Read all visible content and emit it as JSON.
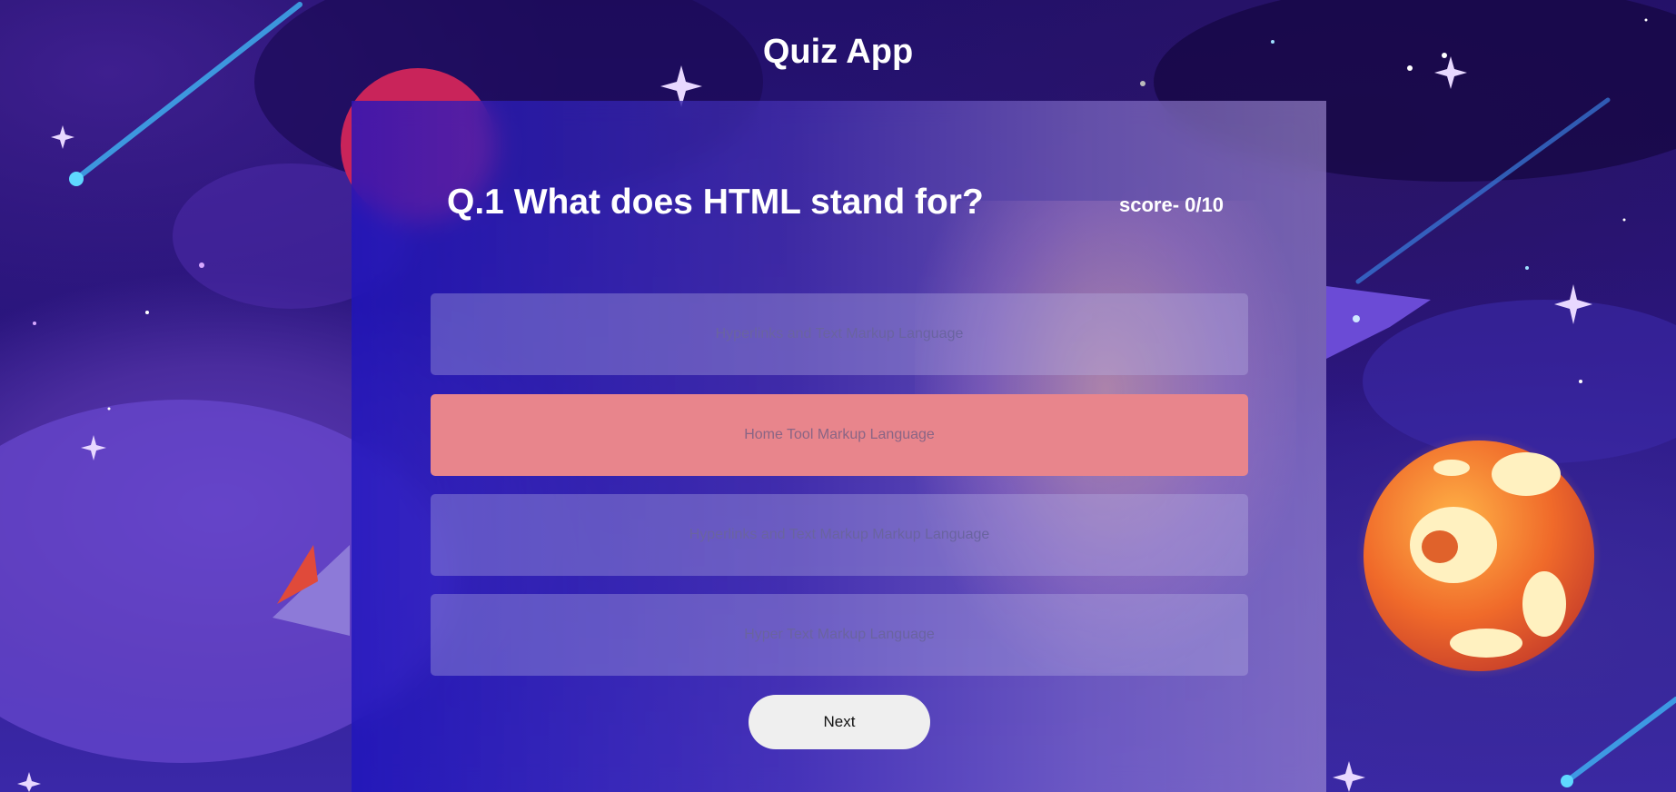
{
  "app": {
    "title": "Quiz App"
  },
  "quiz": {
    "question": "Q.1 What does HTML stand for?",
    "score": "score- 0/10",
    "options": [
      {
        "label": "Hyperlinks and Text Markup Language",
        "state": "default"
      },
      {
        "label": "Home Tool Markup Language",
        "state": "wrong"
      },
      {
        "label": "Hyperlinks and Text Markup Markup Language",
        "state": "default"
      },
      {
        "label": "Hyper Text Markup Language",
        "state": "default"
      }
    ],
    "next_label": "Next"
  },
  "colors": {
    "wrong_answer": "#e8858c",
    "option_default": "#8c86d8",
    "next_button": "#efefef",
    "text": "#ffffff"
  }
}
